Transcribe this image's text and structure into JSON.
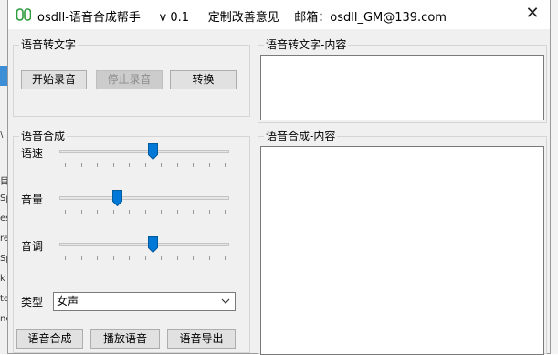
{
  "window": {
    "title": "osdll-语音合成帮手     v 0.1     定制改善意见    邮箱：osdll_GM@139.com",
    "close_glyph": "✕"
  },
  "background": {
    "left_fragments": [
      "\\",
      "目",
      "Sp",
      "es",
      "re",
      "Sp",
      "k",
      "te",
      "ne"
    ]
  },
  "speech_to_text": {
    "label": "语音转文字",
    "start_record": "开始录音",
    "stop_record": "停止录音",
    "convert": "转换"
  },
  "speech_to_text_content": {
    "label": "语音转文字-内容",
    "text": ""
  },
  "synthesis": {
    "label": "语音合成",
    "speed_label": "语速",
    "volume_label": "音量",
    "pitch_label": "音调",
    "speed_level": 0.55,
    "volume_level": 0.34,
    "pitch_level": 0.55,
    "type_label": "类型",
    "type_value": "女声",
    "synthesize": "语音合成",
    "play": "播放语音",
    "export": "语音导出"
  },
  "synthesis_content": {
    "label": "语音合成-内容",
    "text": ""
  },
  "colors": {
    "accent": "#0078d7",
    "icon_green": "#2e9b3c"
  }
}
